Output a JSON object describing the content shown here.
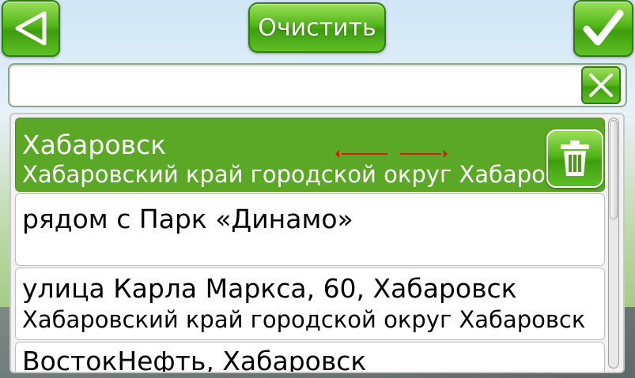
{
  "toolbar": {
    "back_icon": "triangle-left-icon",
    "clear_label": "Очистить",
    "ok_icon": "checkmark-icon"
  },
  "search": {
    "value": "",
    "clear_icon": "close-x-icon"
  },
  "results": [
    {
      "title": "Хабаровск",
      "subtitle": "Хабаровский край городской округ Хабаровск",
      "selected": true
    },
    {
      "title": "рядом с Парк «Динамо»",
      "subtitle": "",
      "selected": false
    },
    {
      "title": "улица Карла Маркса, 60, Хабаровск",
      "subtitle": "Хабаровский край городской округ Хабаровск",
      "selected": false
    },
    {
      "title": "ВостокНефть, Хабаровск",
      "subtitle": "",
      "selected": false
    }
  ],
  "row_actions": {
    "delete_icon": "trash-icon"
  },
  "colors": {
    "accent": "#52b519",
    "selected_row": "#5aa826",
    "swipe_hint": "#e01515"
  }
}
